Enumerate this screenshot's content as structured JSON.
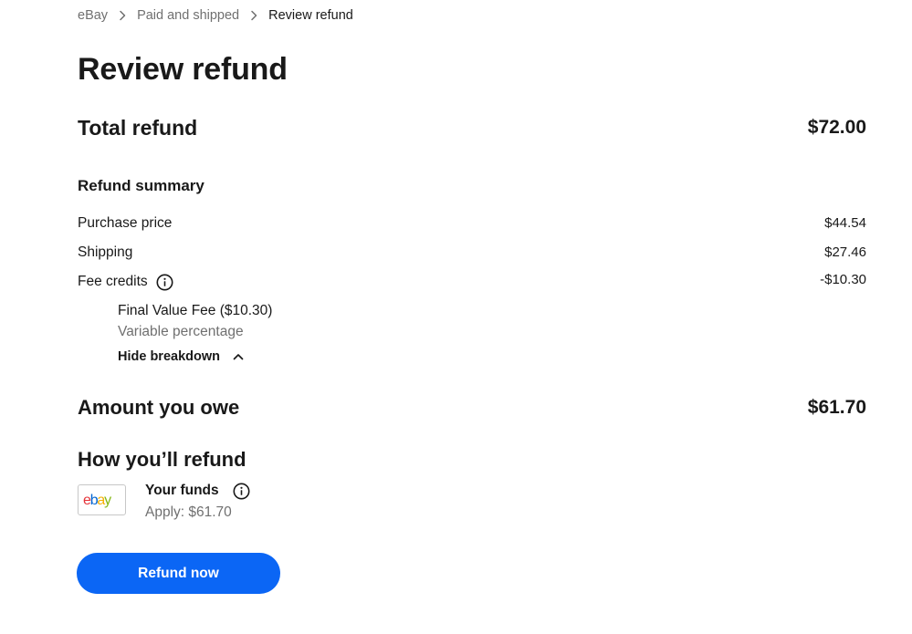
{
  "breadcrumb": {
    "items": [
      "eBay",
      "Paid and shipped"
    ],
    "current": "Review refund"
  },
  "page": {
    "title": "Review refund"
  },
  "total_refund": {
    "label": "Total refund",
    "value": "$72.00"
  },
  "summary": {
    "heading": "Refund summary",
    "rows": [
      {
        "label": "Purchase price",
        "value": "$44.54"
      },
      {
        "label": "Shipping",
        "value": "$27.46"
      },
      {
        "label": "Fee credits",
        "value": "-$10.30"
      }
    ],
    "breakdown": {
      "fee_name": "Final Value Fee ($10.30)",
      "fee_type": "Variable percentage",
      "toggle_label": "Hide breakdown"
    }
  },
  "amount_owe": {
    "label": "Amount you owe",
    "value": "$61.70"
  },
  "how_refund": {
    "heading": "How you’ll refund",
    "method": {
      "logo_text": "ebay",
      "title": "Your funds",
      "apply": "Apply: $61.70"
    }
  },
  "action": {
    "button_label": "Refund now"
  },
  "colors": {
    "primary_button": "#0b66f5",
    "text_primary": "#191919",
    "text_secondary": "#707070",
    "ebay_e": "#e53238",
    "ebay_b": "#0064d2",
    "ebay_a": "#f5af02",
    "ebay_y": "#86b817"
  },
  "icons": [
    "chevron-right-icon",
    "info-icon",
    "chevron-up-icon",
    "ebay-logo"
  ]
}
